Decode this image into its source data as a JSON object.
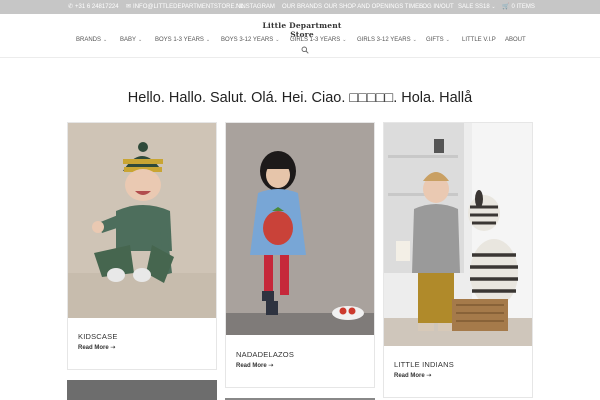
{
  "topbar": {
    "phone": "+31 6 24817224",
    "email": "INFO@LITTLEDEPARTMENTSTORE.NL",
    "links": [
      "INSTAGRAM",
      "OUR BRANDS",
      "OUR SHOP AND OPENINGS TIMES",
      "LOG IN/OUT",
      "SALE SS18"
    ],
    "cart": "0 ITEMS",
    "colors": {
      "bar": "#c6c6c6",
      "text": "#ffffff"
    }
  },
  "header": {
    "logo": "Little Department Store",
    "nav": [
      "BRANDS",
      "BABY",
      "BOYS 1-3 YEARS",
      "BOYS 3-12 YEARS",
      "GIRLS 1-3 YEARS",
      "GIRLS 3-12 YEARS",
      "GIFTS",
      "LITTLE V.I.P",
      "ABOUT"
    ],
    "search_icon": "search-icon"
  },
  "main": {
    "greeting": "Hello. Hallo. Salut. Olá. Hei. Ciao. □□□□□. Hola. Hallå",
    "cards": [
      {
        "title": "KIDSCASE",
        "read_more": "Read More ➝"
      },
      {
        "title": "NADADELAZOS",
        "read_more": "Read More ➝"
      },
      {
        "title": "LITTLE INDIANS",
        "read_more": "Read More ➝"
      }
    ]
  }
}
